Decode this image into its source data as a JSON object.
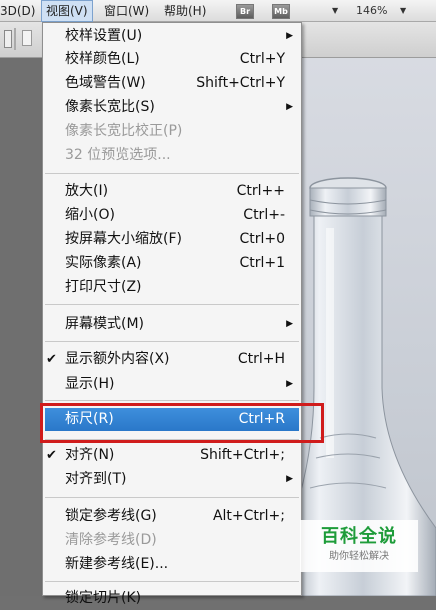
{
  "menubar": {
    "items": [
      "3D(D)",
      "视图(V)",
      "窗口(W)",
      "帮助(H)"
    ],
    "buttons": [
      "Br",
      "Mb"
    ],
    "zoom": "146%"
  },
  "view_menu": {
    "items": [
      {
        "label": "校样设置(U)",
        "shortcut": "",
        "submenu": true
      },
      {
        "label": "校样颜色(L)",
        "shortcut": "Ctrl+Y"
      },
      {
        "label": "色域警告(W)",
        "shortcut": "Shift+Ctrl+Y"
      },
      {
        "label": "像素长宽比(S)",
        "shortcut": "",
        "submenu": true
      },
      {
        "label": "像素长宽比校正(P)",
        "shortcut": "",
        "disabled": true
      },
      {
        "label": "32 位预览选项...",
        "shortcut": "",
        "disabled": true
      },
      {
        "label": "放大(I)",
        "shortcut": "Ctrl++"
      },
      {
        "label": "缩小(O)",
        "shortcut": "Ctrl+-"
      },
      {
        "label": "按屏幕大小缩放(F)",
        "shortcut": "Ctrl+0"
      },
      {
        "label": "实际像素(A)",
        "shortcut": "Ctrl+1"
      },
      {
        "label": "打印尺寸(Z)",
        "shortcut": ""
      },
      {
        "label": "屏幕模式(M)",
        "shortcut": "",
        "submenu": true
      },
      {
        "label": "显示额外内容(X)",
        "shortcut": "Ctrl+H",
        "checked": true
      },
      {
        "label": "显示(H)",
        "shortcut": "",
        "submenu": true
      },
      {
        "label": "标尺(R)",
        "shortcut": "Ctrl+R",
        "highlighted": true
      },
      {
        "label": "对齐(N)",
        "shortcut": "Shift+Ctrl+;",
        "checked": true
      },
      {
        "label": "对齐到(T)",
        "shortcut": "",
        "submenu": true
      },
      {
        "label": "锁定参考线(G)",
        "shortcut": "Alt+Ctrl+;"
      },
      {
        "label": "清除参考线(D)",
        "shortcut": "",
        "disabled": true
      },
      {
        "label": "新建参考线(E)...",
        "shortcut": ""
      },
      {
        "label": "锁定切片(K)",
        "shortcut": ""
      }
    ]
  },
  "watermark": {
    "title": "百科全说",
    "subtitle": "助你轻松解决"
  },
  "colors": {
    "highlight": "#2a78c9",
    "callout_box": "#d01c1c",
    "watermark_green": "#1e9c3a"
  }
}
